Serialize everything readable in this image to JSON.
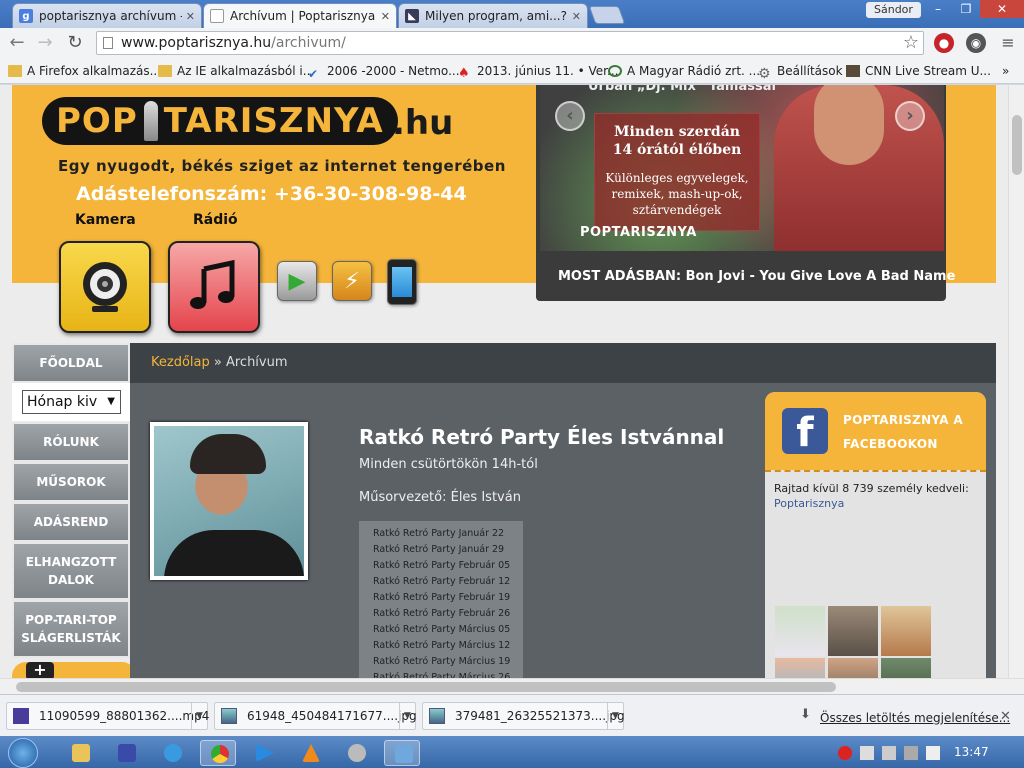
{
  "browser": {
    "tabs": [
      {
        "label": "poptarisznya archívum - G",
        "active": false
      },
      {
        "label": "Archívum | Poptarisznya -",
        "active": true
      },
      {
        "label": "Milyen program, ami...? -",
        "active": false
      }
    ],
    "user": "Sándor",
    "url_host": "www.poptarisznya.hu",
    "url_path": "/archivum/",
    "bookmarks": [
      "A Firefox alkalmazás...",
      "Az IE alkalmazásból i...",
      "2006 -2000 - Netmo...",
      "2013. június 11. • Ver...",
      "A Magyar Rádió zrt. ...",
      "Beállítások",
      "CNN Live Stream  U..."
    ]
  },
  "site": {
    "logo_pop": "POP",
    "logo_tar": "TARISZNYA",
    "logo_hu": ".hu",
    "tagline": "Egy nyugodt, békés sziget az internet tengerében",
    "phone": "Adástelefonszám: +36-30-308-98-44",
    "camera_label": "Kamera",
    "radio_label": "Rádió",
    "slide": {
      "caption_top": "Urbán „Dj. Mix” Tamással",
      "box_line1": "Minden szerdán",
      "box_line1b": "14 órától élőben",
      "box_line2": "Különleges egyvelegek,",
      "box_line2b": "remixek, mash-up-ok,",
      "box_line2c": "sztárvendégek",
      "badge": "POPTARISZNYA"
    },
    "now_playing": "MOST ADÁSBAN: Bon Jovi - You Give Love A Bad Name"
  },
  "nav": {
    "items": [
      "FŐOLDAL",
      "RÓLUNK",
      "MŰSOROK",
      "ADÁSREND",
      "ELHANGZOTT DALOK",
      "POP-TARI-TOP SLÁGERLISTÁK"
    ],
    "month_select": "Hónap kiv"
  },
  "breadcrumb": {
    "home": "Kezdőlap",
    "sep": " » ",
    "current": "Archívum"
  },
  "post": {
    "title": "Ratkó Retró Party Éles Istvánnal",
    "subtitle": "Minden csütörtökön 14h-tól",
    "host": "Műsorvezető: Éles István",
    "episodes": [
      "Ratkó Retró Party Január 22",
      "Ratkó Retró Party Január 29",
      "Ratkó Retró Party Február 05",
      "Ratkó Retró Party Február 12",
      "Ratkó Retró Party Február 19",
      "Ratkó Retró Party Február 26",
      "Ratkó Retró Party Március 05",
      "Ratkó Retró Party Március 12",
      "Ratkó Retró Party Március 19",
      "Ratkó Retró Party Március 26"
    ]
  },
  "facebook": {
    "title": "POPTARISZNYA A FACEBOOKON",
    "likes": "Rajtad kívül 8 739 személy kedveli:",
    "page": "Poptarisznya"
  },
  "downloads": {
    "files": [
      "11090599_88801362....mp4",
      "61948_450484171677....jpg",
      "379481_26325521373....jpg"
    ],
    "show_all": "Összes letöltés megjelenítése..."
  },
  "taskbar": {
    "clock": "13:47"
  },
  "colors": {
    "accent": "#f4b53a",
    "panel": "#5c6166",
    "fb": "#3b5998"
  }
}
